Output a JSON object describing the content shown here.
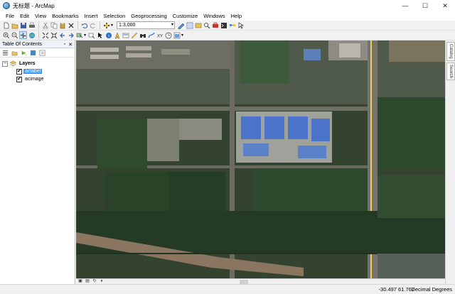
{
  "window": {
    "title": "无标题 - ArcMap",
    "minimize": "—",
    "maximize": "☐",
    "close": "✕"
  },
  "menu": [
    "File",
    "Edit",
    "View",
    "Bookmarks",
    "Insert",
    "Selection",
    "Geoprocessing",
    "Customize",
    "Windows",
    "Help"
  ],
  "toolbar": {
    "scale_value": "1:3,000",
    "scale_dropdown": "▾"
  },
  "toc": {
    "title": "Table Of Contents",
    "pin": "▫",
    "close": "✕",
    "root_label": "Layers",
    "root_expander": "−",
    "layers": [
      {
        "name": "aclabel",
        "checked": "✔",
        "selected": true
      },
      {
        "name": "acimage",
        "checked": "✔",
        "selected": false
      }
    ]
  },
  "right_dock": {
    "tabs": [
      "Catalog",
      "Search"
    ]
  },
  "status": {
    "coordinates": "-30.497  61.767",
    "units": "Decimal Degrees"
  },
  "colors": {
    "selection_highlight": "#3399ff",
    "building_roof": "#4a73c9",
    "field_green": "#2f4a2d"
  }
}
